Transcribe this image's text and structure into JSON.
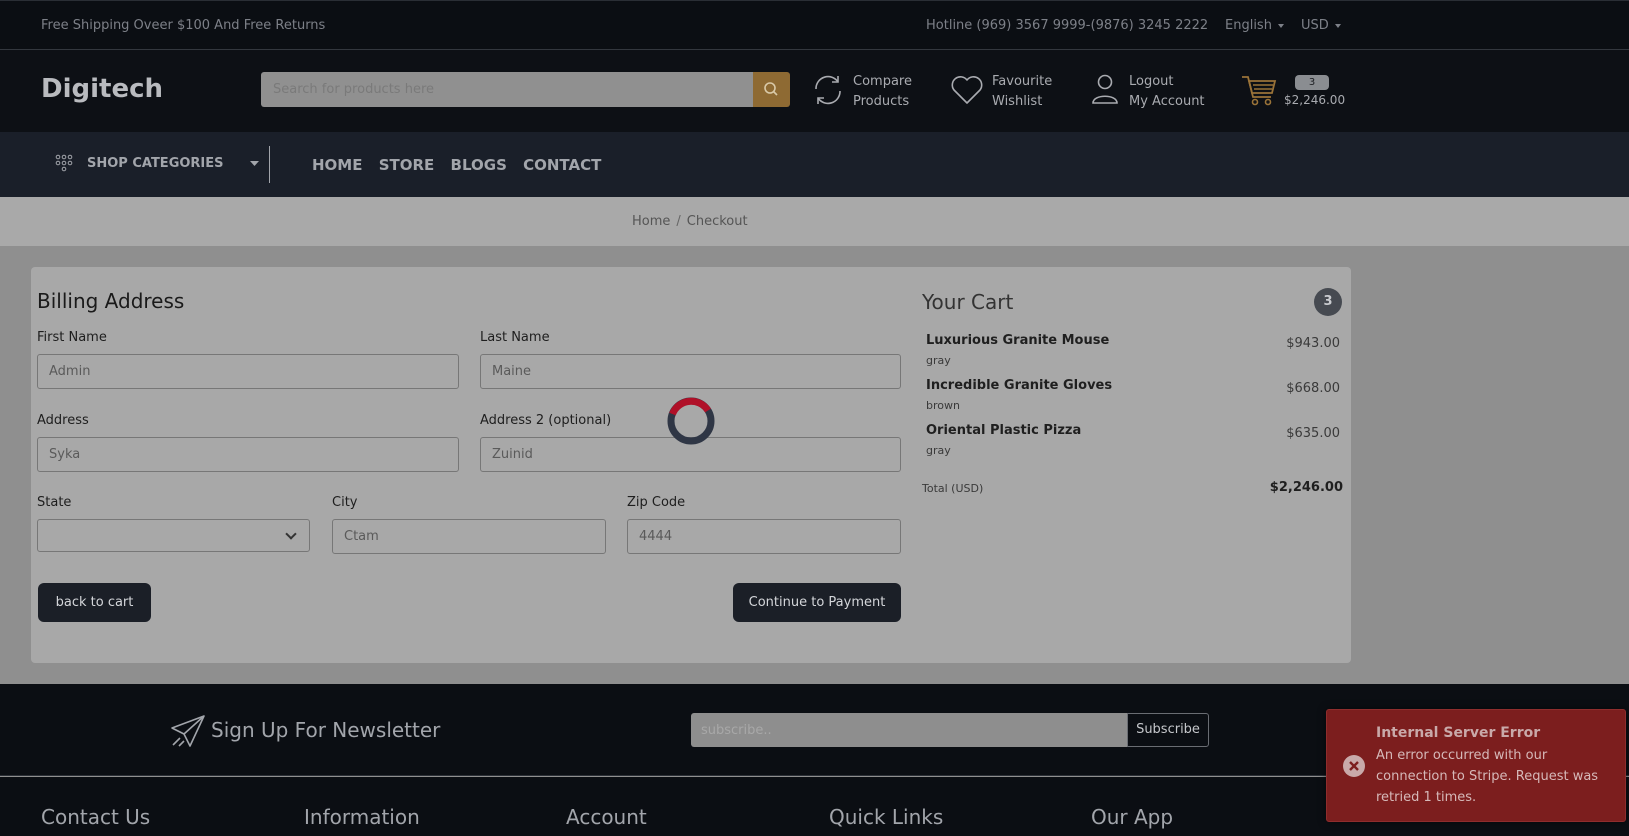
{
  "topbar": {
    "shipping": "Free Shipping Oveer $100 And Free Returns",
    "hotline": "Hotline (969) 3567 9999-(9876) 3245 2222",
    "language": "English",
    "currency": "USD"
  },
  "header": {
    "logo": "Digitech",
    "search_placeholder": "Search for products here",
    "compare_line1": "Compare",
    "compare_line2": "Products",
    "favourite_line1": "Favourite",
    "favourite_line2": "Wishlist",
    "account_line1": "Logout",
    "account_line2": "My Account",
    "cart_count": "3",
    "cart_total": "$2,246.00"
  },
  "nav": {
    "shop_categories": "SHOP CATEGORIES",
    "links": [
      "HOME",
      "STORE",
      "BLOGS",
      "CONTACT"
    ]
  },
  "breadcrumb": {
    "home": "Home",
    "separator": "/",
    "current": "Checkout"
  },
  "billing": {
    "title": "Billing Address",
    "first_name_label": "First Name",
    "first_name_value": "Admin",
    "last_name_label": "Last Name",
    "last_name_value": "Maine",
    "address_label": "Address",
    "address_value": "Syka",
    "address2_label": "Address 2 (optional)",
    "address2_value": "Zuinid",
    "state_label": "State",
    "state_value": "",
    "city_label": "City",
    "city_value": "Ctam",
    "zip_label": "Zip Code",
    "zip_value": "4444",
    "back_button": "back to cart",
    "continue_button": "Continue to Payment"
  },
  "cart": {
    "title": "Your Cart",
    "count": "3",
    "items": [
      {
        "name": "Luxurious Granite Mouse",
        "variant": "gray",
        "price": "$943.00"
      },
      {
        "name": "Incredible Granite Gloves",
        "variant": "brown",
        "price": "$668.00"
      },
      {
        "name": "Oriental Plastic Pizza",
        "variant": "gray",
        "price": "$635.00"
      }
    ],
    "total_label": "Total (USD)",
    "total_value": "$2,246.00"
  },
  "newsletter": {
    "title": "Sign Up For Newsletter",
    "placeholder": "subscribe..",
    "button": "Subscribe"
  },
  "footer": {
    "headings": [
      "Contact Us",
      "Information",
      "Account",
      "Quick Links",
      "Our App"
    ]
  },
  "toast": {
    "title": "Internal Server Error",
    "message": "An error occurred with our connection to Stripe. Request was retried 1 times."
  },
  "colors": {
    "accent": "#8e6a33",
    "error": "#7c1e1e",
    "spinner": "#c8102e"
  }
}
